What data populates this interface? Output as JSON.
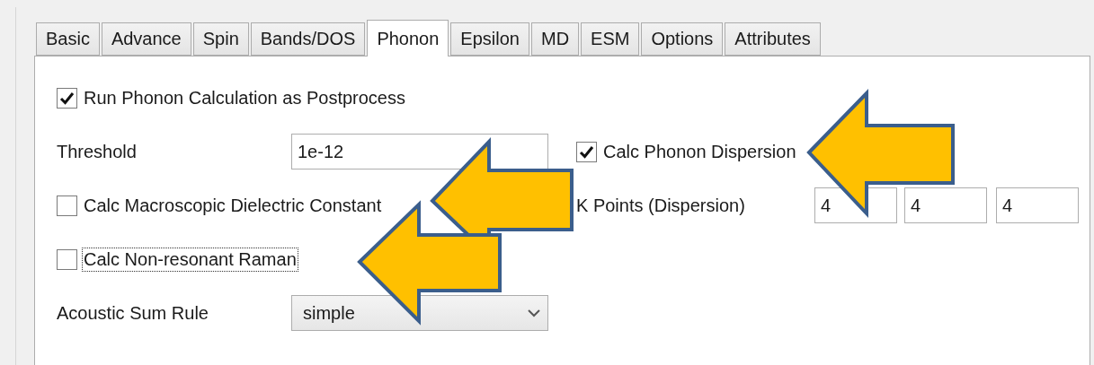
{
  "tabs": [
    {
      "label": "Basic",
      "selected": false
    },
    {
      "label": "Advance",
      "selected": false
    },
    {
      "label": "Spin",
      "selected": false
    },
    {
      "label": "Bands/DOS",
      "selected": false
    },
    {
      "label": "Phonon",
      "selected": true
    },
    {
      "label": "Epsilon",
      "selected": false
    },
    {
      "label": "MD",
      "selected": false
    },
    {
      "label": "ESM",
      "selected": false
    },
    {
      "label": "Options",
      "selected": false
    },
    {
      "label": "Attributes",
      "selected": false
    }
  ],
  "run_phonon": {
    "label": "Run Phonon Calculation as Postprocess",
    "checked": true
  },
  "threshold": {
    "label": "Threshold",
    "value": "1e-12"
  },
  "dispersion": {
    "label": "Calc Phonon Dispersion",
    "checked": true
  },
  "macroscopic": {
    "label": "Calc Macroscopic Dielectric Constant",
    "checked": false
  },
  "k_points": {
    "label": "K Points (Dispersion)",
    "values": [
      "4",
      "4",
      "4"
    ]
  },
  "raman": {
    "label": "Calc Non-resonant Raman",
    "checked": false,
    "focused": true
  },
  "acoustic_sum_rule": {
    "label": "Acoustic Sum Rule",
    "value": "simple"
  }
}
